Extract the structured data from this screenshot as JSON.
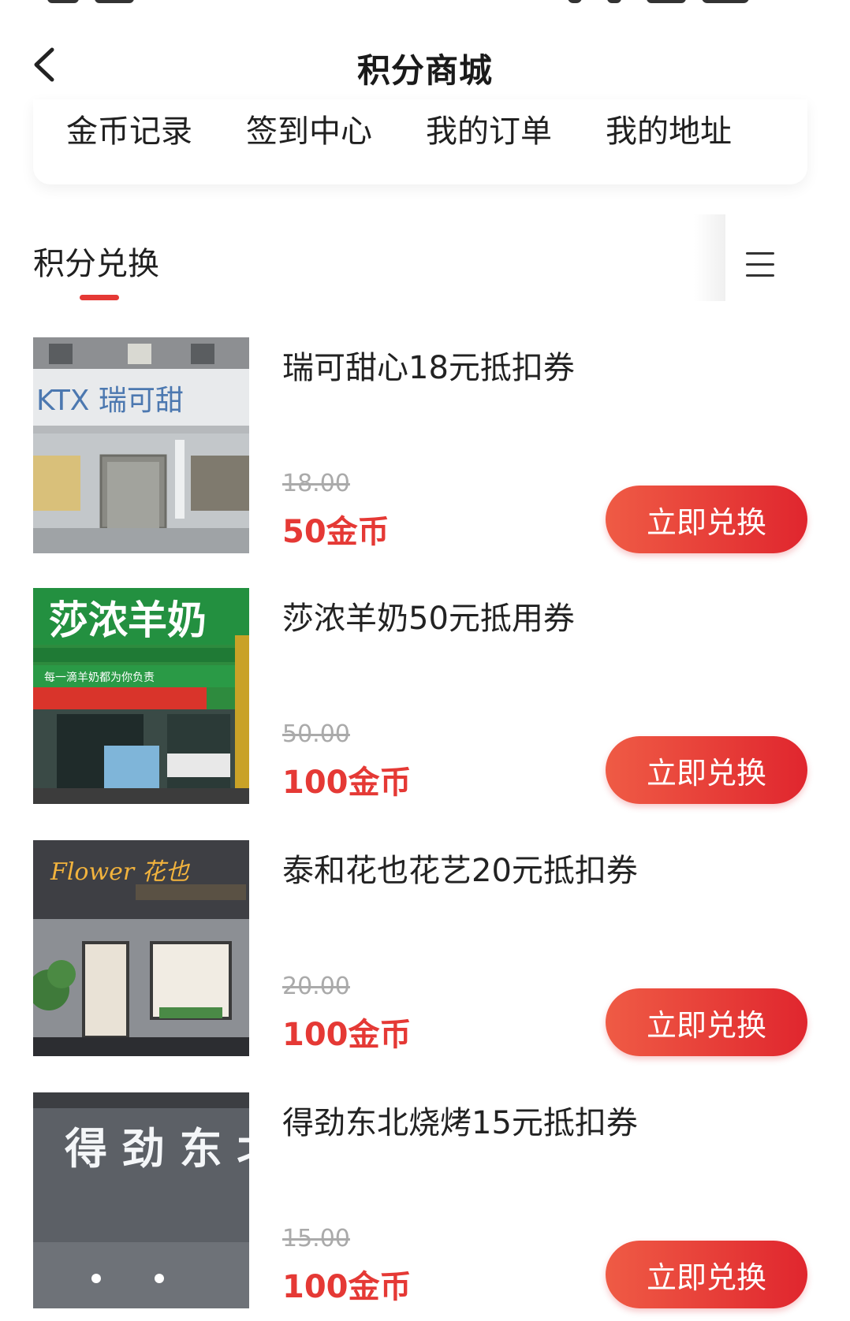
{
  "header": {
    "title": "积分商城"
  },
  "quick_menu": [
    {
      "label": "金币记录"
    },
    {
      "label": "签到中心"
    },
    {
      "label": "我的订单"
    },
    {
      "label": "我的地址"
    }
  ],
  "tabs": {
    "active_label": "积分兑换"
  },
  "accent_color": "#e53935",
  "products": [
    {
      "name": "瑞可甜心18元抵扣券",
      "original_price": "18.00",
      "coins": "50金币",
      "button_label": "立即兑换",
      "storefront_sign": "KTX 瑞可甜"
    },
    {
      "name": "莎浓羊奶50元抵用券",
      "original_price": "50.00",
      "coins": "100金币",
      "button_label": "立即兑换",
      "storefront_sign": "莎浓羊奶",
      "storefront_slogan": "每一滴羊奶都为你负责"
    },
    {
      "name": "泰和花也花艺20元抵扣券",
      "original_price": "20.00",
      "coins": "100金币",
      "button_label": "立即兑换",
      "storefront_sign": "Flower 花也"
    },
    {
      "name": "得劲东北烧烤15元抵扣券",
      "original_price": "15.00",
      "coins": "100金币",
      "button_label": "立即兑换",
      "storefront_sign": "得 劲 东 北 烧"
    }
  ]
}
